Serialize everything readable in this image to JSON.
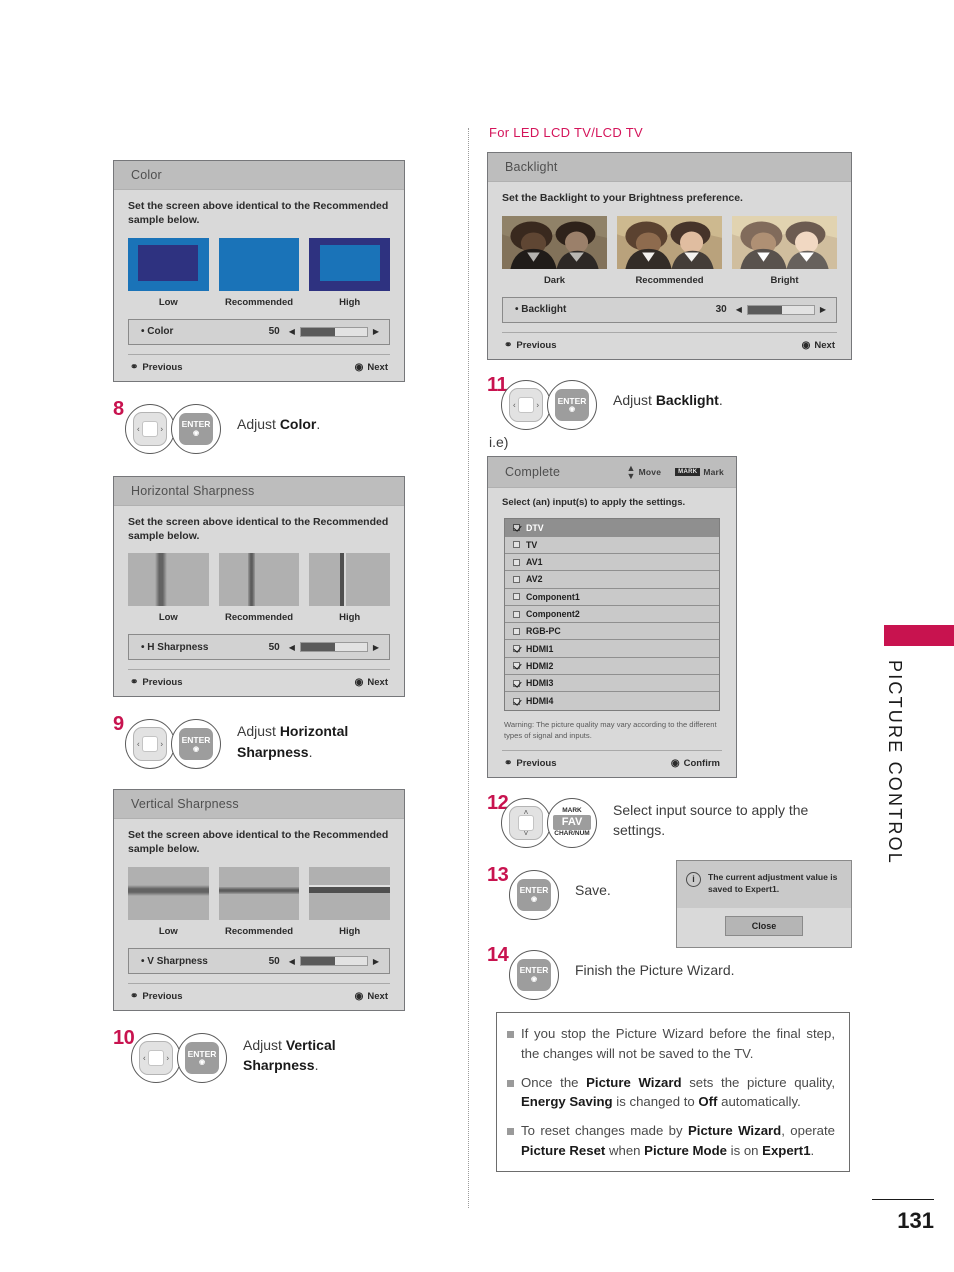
{
  "page": {
    "number": "131",
    "section_label": "PICTURE CONTROL"
  },
  "right_header": "For LED LCD TV/LCD TV",
  "ie_label": "i.e)",
  "common": {
    "desc_sample": "Set the screen above identical to the Recommended sample below.",
    "previous": "Previous",
    "next": "Next",
    "confirm": "Confirm",
    "low": "Low",
    "recommended": "Recommended",
    "high": "High",
    "prev_glyph": "⤴",
    "next_glyph": "◉"
  },
  "panels": {
    "color": {
      "title": "Color",
      "desc": "Set the screen above identical to the Recommended sample below.",
      "sample_labels": [
        "Low",
        "Recommended",
        "High"
      ],
      "setting_name": "Color",
      "setting_value": "50",
      "fill_percent": 52,
      "footer_left": "Previous",
      "footer_right": "Next",
      "swatch_colors": {
        "blue": "#1a73b8",
        "navy": "#2e3280"
      }
    },
    "h_sharpness": {
      "title": "Horizontal Sharpness",
      "desc": "Set the screen above identical to the Recommended sample below.",
      "sample_labels": [
        "Low",
        "Recommended",
        "High"
      ],
      "setting_name": "H Sharpness",
      "setting_value": "50",
      "fill_percent": 52,
      "footer_left": "Previous",
      "footer_right": "Next"
    },
    "v_sharpness": {
      "title": "Vertical Sharpness",
      "desc": "Set the screen above identical to the Recommended sample below.",
      "sample_labels": [
        "Low",
        "Recommended",
        "High"
      ],
      "setting_name": "V Sharpness",
      "setting_value": "50",
      "fill_percent": 52,
      "footer_left": "Previous",
      "footer_right": "Next"
    },
    "backlight": {
      "title": "Backlight",
      "desc": "Set the Backlight to your Brightness preference.",
      "sample_labels": [
        "Dark",
        "Recommended",
        "Bright"
      ],
      "setting_name": "Backlight",
      "setting_value": "30",
      "fill_percent": 52,
      "footer_left": "Previous",
      "footer_right": "Next"
    },
    "complete": {
      "title": "Complete",
      "hint_move": "Move",
      "hint_mark": "Mark",
      "mark_chip": "MARK",
      "desc": "Select (an) input(s) to apply the settings.",
      "inputs": [
        {
          "label": "DTV",
          "checked": true,
          "selected": true
        },
        {
          "label": "TV",
          "checked": false,
          "selected": false
        },
        {
          "label": "AV1",
          "checked": false,
          "selected": false
        },
        {
          "label": "AV2",
          "checked": false,
          "selected": false
        },
        {
          "label": "Component1",
          "checked": false,
          "selected": false
        },
        {
          "label": "Component2",
          "checked": false,
          "selected": false
        },
        {
          "label": "RGB-PC",
          "checked": false,
          "selected": false
        },
        {
          "label": "HDMI1",
          "checked": true,
          "selected": false
        },
        {
          "label": "HDMI2",
          "checked": true,
          "selected": false
        },
        {
          "label": "HDMI3",
          "checked": true,
          "selected": false
        },
        {
          "label": "HDMI4",
          "checked": true,
          "selected": false
        }
      ],
      "warning": "Warning: The picture quality may vary according to the different types of signal and inputs.",
      "footer_left": "Previous",
      "footer_right": "Confirm"
    }
  },
  "steps": {
    "s8": {
      "num": "8",
      "text_pre": "Adjust ",
      "text_bold": "Color",
      "text_post": "."
    },
    "s9": {
      "num": "9",
      "text_pre": "Adjust ",
      "text_bold": "Horizontal Sharpness",
      "text_post": "."
    },
    "s10": {
      "num": "10",
      "text_pre": "Adjust ",
      "text_bold": "Vertical Sharpness",
      "text_post": "."
    },
    "s11": {
      "num": "11",
      "text_pre": "Adjust ",
      "text_bold": "Backlight",
      "text_post": "."
    },
    "s12": {
      "num": "12",
      "text": "Select input source to apply the settings."
    },
    "s13": {
      "num": "13",
      "text": "Save."
    },
    "s14": {
      "num": "14",
      "text": "Finish the Picture Wizard."
    }
  },
  "keys": {
    "enter": "ENTER",
    "enter_dot": "◉",
    "mark": "MARK",
    "fav": "FAV",
    "charnum": "CHAR/NUM",
    "left": "‹",
    "right": "›",
    "up": "˄",
    "down": "˅"
  },
  "dialog": {
    "message": "The current adjustment value is saved to Expert1.",
    "button": "Close",
    "icon": "i"
  },
  "notes": [
    {
      "parts": [
        {
          "t": "If you stop the Picture Wizard before the final step, the changes will not be saved to the TV.",
          "b": false
        }
      ]
    },
    {
      "parts": [
        {
          "t": "Once the ",
          "b": false
        },
        {
          "t": "Picture Wizard",
          "b": true
        },
        {
          "t": " sets the picture quality, ",
          "b": false
        },
        {
          "t": "Energy Saving",
          "b": true
        },
        {
          "t": " is changed to ",
          "b": false
        },
        {
          "t": "Off",
          "b": true
        },
        {
          "t": " automatically.",
          "b": false
        }
      ]
    },
    {
      "parts": [
        {
          "t": "To reset changes made by ",
          "b": false
        },
        {
          "t": "Picture Wizard",
          "b": true
        },
        {
          "t": ", operate ",
          "b": false
        },
        {
          "t": "Picture Reset",
          "b": true
        },
        {
          "t": " when ",
          "b": false
        },
        {
          "t": "Picture Mode",
          "b": true
        },
        {
          "t": " is on ",
          "b": false
        },
        {
          "t": "Expert1",
          "b": true
        },
        {
          "t": ".",
          "b": false
        }
      ]
    }
  ],
  "colors": {
    "accent": "#c8134f",
    "header_red": "#d4145a",
    "osd_bg": "#d9d9d9",
    "osd_head": "#bdbdbd"
  }
}
